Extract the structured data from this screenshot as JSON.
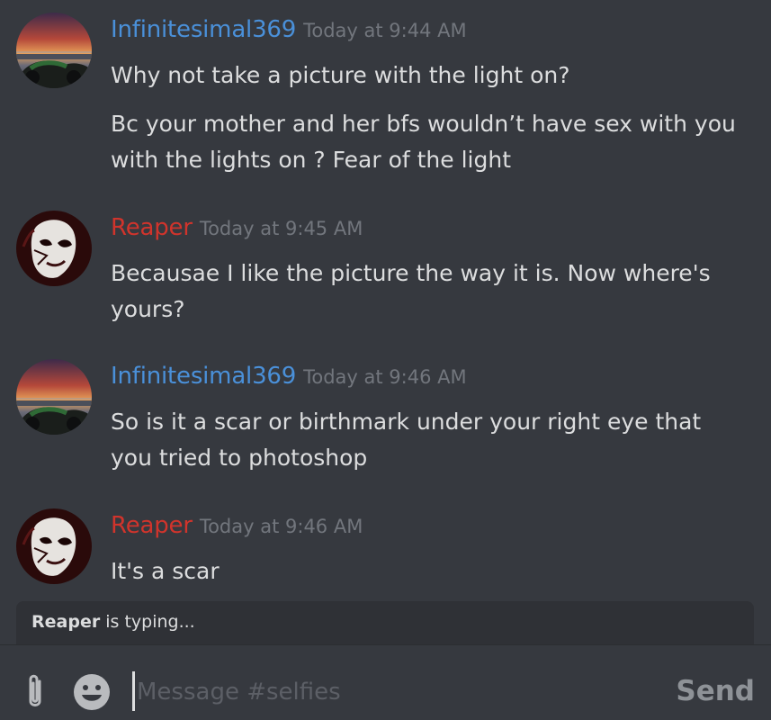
{
  "users": {
    "infinitesimal": {
      "name": "Infinitesimal369",
      "color": "#4a90d9"
    },
    "reaper": {
      "name": "Reaper",
      "color": "#d0342c"
    }
  },
  "messages": [
    {
      "author": "Infinitesimal369",
      "timestamp": "Today at 9:44 AM",
      "lines": [
        "Why not take a picture with the light on?",
        "Bc your mother and her bfs wouldn’t have sex with you",
        "with the lights on ? Fear of the light"
      ]
    },
    {
      "author": "Reaper",
      "timestamp": "Today at 9:45 AM",
      "lines": [
        "Becausae I like the picture the way it is. Now where's",
        "yours?"
      ]
    },
    {
      "author": "Infinitesimal369",
      "timestamp": "Today at 9:46 AM",
      "lines": [
        "So is it a scar or birthmark under your right eye that",
        "you tried to photoshop"
      ]
    },
    {
      "author": "Reaper",
      "timestamp": "Today at 9:46 AM",
      "lines": [
        "It's a scar"
      ]
    }
  ],
  "typing": {
    "user": "Reaper",
    "suffix": " is typing..."
  },
  "composer": {
    "placeholder": "Message #selfies",
    "send_label": "Send"
  },
  "icons": {
    "attach": "paperclip-icon",
    "emoji": "emoji-icon",
    "avatar_infinitesimal": "sunset-motorcycle-avatar",
    "avatar_reaper": "mask-avatar"
  }
}
